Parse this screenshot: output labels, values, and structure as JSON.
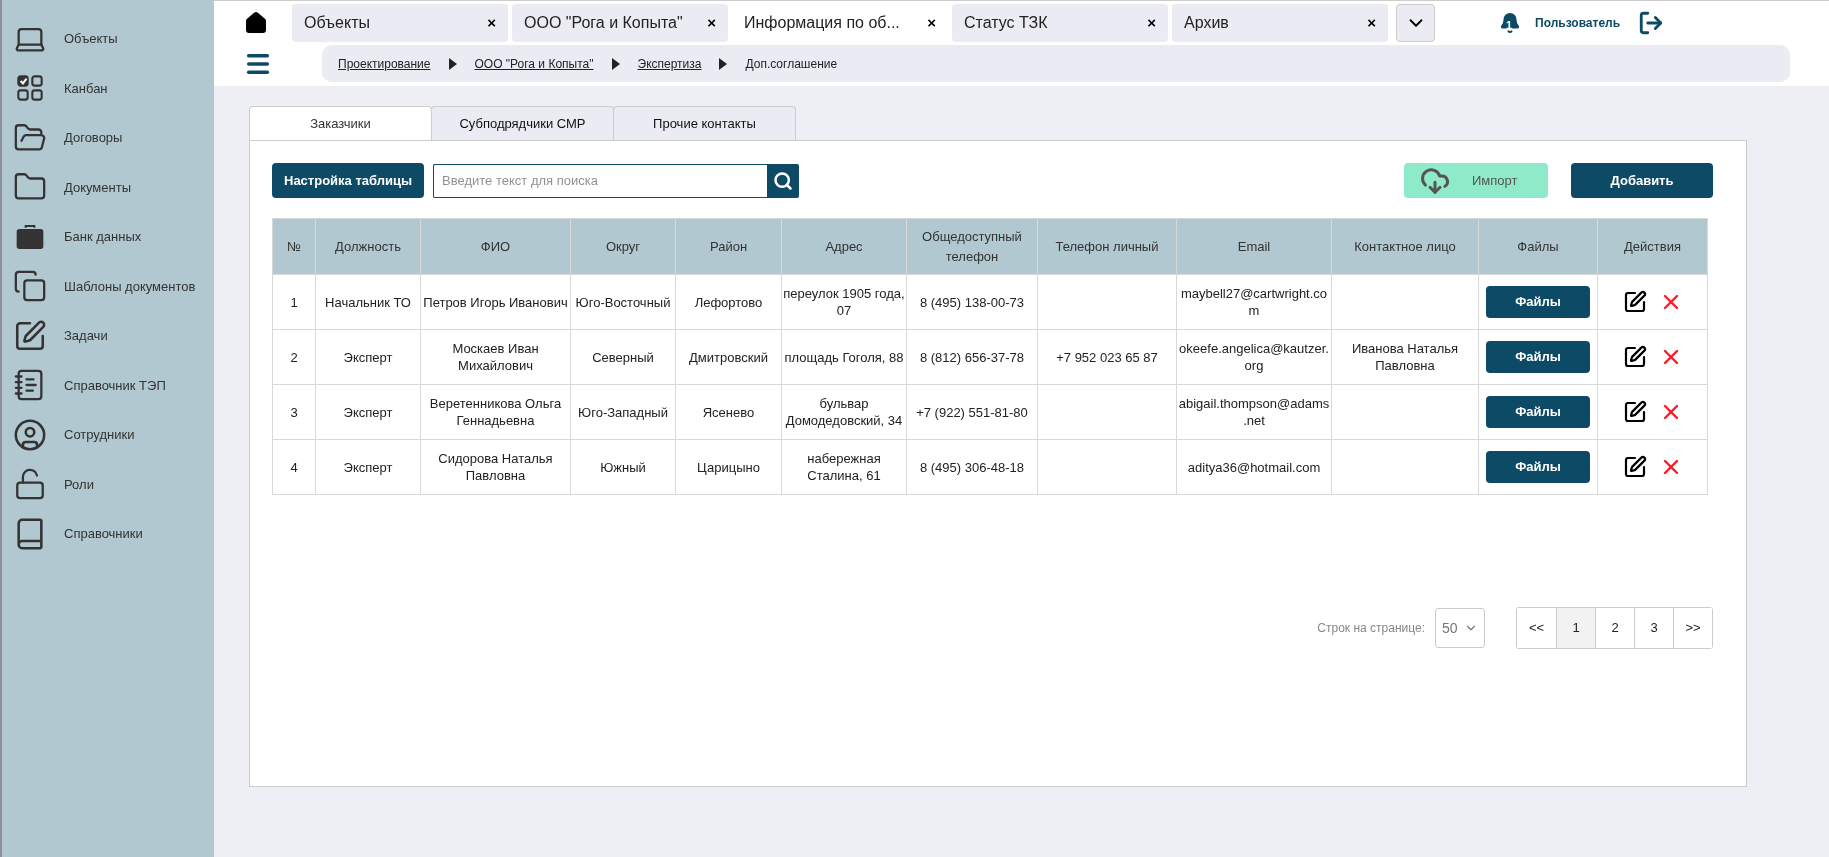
{
  "sidebar": {
    "items": [
      {
        "label": "Объекты"
      },
      {
        "label": "Канбан"
      },
      {
        "label": "Договоры"
      },
      {
        "label": "Документы"
      },
      {
        "label": "Банк данных"
      },
      {
        "label": "Шаблоны документов"
      },
      {
        "label": "Задачи"
      },
      {
        "label": "Справочник ТЭП"
      },
      {
        "label": "Сотрудники"
      },
      {
        "label": "Роли"
      },
      {
        "label": "Справочники"
      }
    ]
  },
  "top_tabs": [
    {
      "label": "Объекты",
      "close": "×",
      "selected": false
    },
    {
      "label": "ООО \"Рога и Копыта\"",
      "close": "×",
      "selected": false
    },
    {
      "label": "Информация по об...",
      "close": "×",
      "selected": true
    },
    {
      "label": "Статус ТЗК",
      "close": "×",
      "selected": false
    },
    {
      "label": "Архив",
      "close": "×",
      "selected": false
    }
  ],
  "notifications": {
    "count": "1"
  },
  "user": "Пользователь",
  "breadcrumbs": [
    "Проектирование",
    "ООО \"Рога и Копыта\"",
    "Экспертиза",
    "Доп.соглашение"
  ],
  "content_tabs": [
    {
      "label": "Заказчики",
      "selected": true
    },
    {
      "label": "Субподрядчики СМР",
      "selected": false
    },
    {
      "label": "Прочие контакты",
      "selected": false
    }
  ],
  "toolbar": {
    "settings_button": "Настройка таблицы",
    "search": {
      "placeholder": "Введите текст для поиска"
    },
    "import_button": "Импорт",
    "add_button": "Добавить"
  },
  "table": {
    "columns": [
      "№",
      "Должность",
      "ФИО",
      "Округ",
      "Район",
      "Адрес",
      "Общедоступный телефон",
      "Телефон личный",
      "Email",
      "Контактное лицо",
      "Файлы",
      "Действия"
    ],
    "rows": [
      {
        "number": "1",
        "position": "Начальник ТО",
        "name": "Петров Игорь Иванович",
        "district": "Юго-Восточный",
        "area": "Лефортово",
        "address": "переулок 1905 года, 07",
        "phone_public": "8 (495) 138-00-73",
        "email": "maybell27@cartwright.com",
        "files_button": "Файлы"
      },
      {
        "number": "2",
        "position": "Эксперт",
        "name": "Москаев Иван Михайлович",
        "district": "Северный",
        "area": "Дмитровский",
        "address": "площадь Гоголя, 88",
        "phone_public": "8 (812) 656-37-78",
        "phone_personal": "+7 952 023 65 87",
        "email": "okeefe.angelica@kautzer.org",
        "contact": "Иванова Наталья Павловна",
        "files_button": "Файлы"
      },
      {
        "number": "3",
        "position": "Эксперт",
        "name": "Веретенникова Ольга Геннадьевна",
        "district": "Юго-Западный",
        "area": "Ясенево",
        "address": "бульвар Домодедовский, 34",
        "phone_public": "+7 (922) 551-81-80",
        "email": "abigail.thompson@adams.net",
        "files_button": "Файлы"
      },
      {
        "number": "4",
        "position": "Эксперт",
        "name": "Сидорова Наталья Павловна",
        "district": "Южный",
        "area": "Царицыно",
        "address": "набережная Сталина, 61",
        "phone_public": "8 (495) 306-48-18",
        "email": "aditya36@hotmail.com",
        "files_button": "Файлы"
      }
    ]
  },
  "pagination": {
    "rows_label": "Строк на странице:",
    "rows_per_page": "50",
    "pages": [
      {
        "label": "<<",
        "selected": false
      },
      {
        "label": "1",
        "selected": true
      },
      {
        "label": "2",
        "selected": false
      },
      {
        "label": "3",
        "selected": false
      },
      {
        "label": ">>",
        "selected": false
      }
    ]
  }
}
